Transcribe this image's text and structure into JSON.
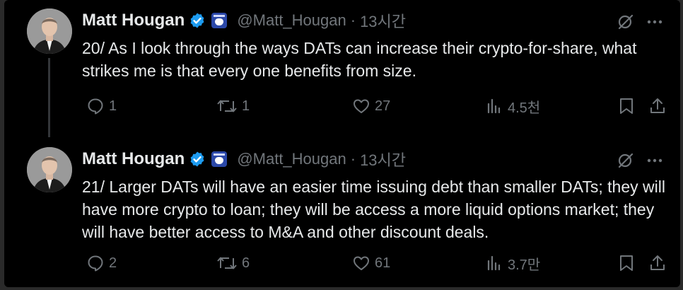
{
  "tweets": [
    {
      "author_name": "Matt Hougan",
      "handle": "@Matt_Hougan",
      "separator": "·",
      "time": "13시간",
      "text": "20/ As I look through the ways DATs can increase their crypto-for-share, what strikes me is that every one benefits from size.",
      "replies": "1",
      "reposts": "1",
      "likes": "27",
      "views": "4.5천"
    },
    {
      "author_name": "Matt Hougan",
      "handle": "@Matt_Hougan",
      "separator": "·",
      "time": "13시간",
      "text": "21/ Larger DATs will have an easier time issuing debt than smaller DATs; they will have more crypto to loan; they will be access a more liquid options market; they will have better access to M&A and other discount deals.",
      "replies": "2",
      "reposts": "6",
      "likes": "61",
      "views": "3.7만"
    }
  ],
  "colors": {
    "background": "#000000",
    "text": "#e7e9ea",
    "muted": "#71767b",
    "verified": "#1d9bf0",
    "thread_line": "#333639"
  },
  "icons": [
    "verified-badge-icon",
    "affiliate-badge-icon",
    "grok-icon",
    "more-icon",
    "reply-icon",
    "repost-icon",
    "like-icon",
    "views-icon",
    "bookmark-icon",
    "share-icon"
  ]
}
